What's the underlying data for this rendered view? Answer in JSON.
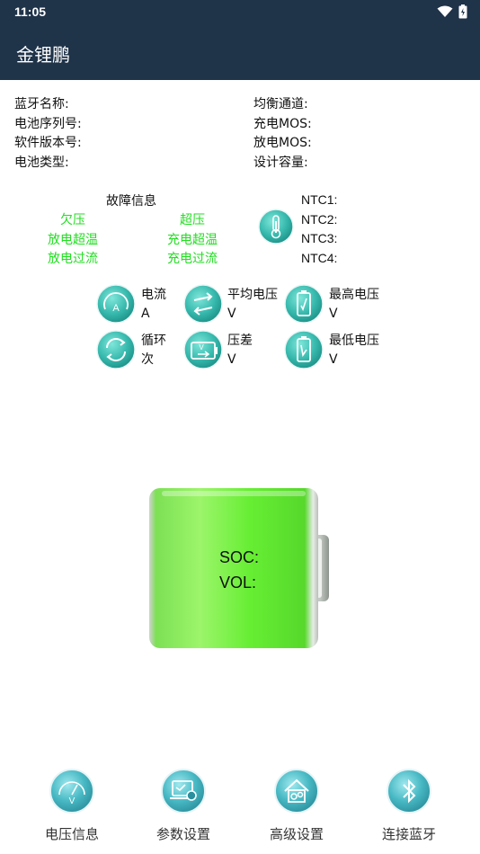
{
  "status_bar": {
    "time": "11:05"
  },
  "app_bar": {
    "title": "金锂鹏"
  },
  "info_left": [
    "蓝牙名称:",
    "电池序列号:",
    "软件版本号:",
    "电池类型:"
  ],
  "info_right": [
    "均衡通道:",
    "充电MOS:",
    "放电MOS:",
    "设计容量:"
  ],
  "fault": {
    "title": "故障信息",
    "items": [
      "欠压",
      "超压",
      "放电超温",
      "充电超温",
      "放电过流",
      "充电过流"
    ]
  },
  "ntc": [
    "NTC1:",
    "NTC2:",
    "NTC3:",
    "NTC4:"
  ],
  "metrics": {
    "current": {
      "label": "电流",
      "unit": "A",
      "icon": "ammeter-icon"
    },
    "avg_voltage": {
      "label": "平均电压",
      "unit": "V",
      "icon": "exchange-arrows-icon"
    },
    "max_voltage": {
      "label": "最高电压",
      "unit": "V",
      "icon": "battery-high-icon"
    },
    "cycles": {
      "label": "循环",
      "unit": "次",
      "icon": "cycle-icon"
    },
    "diff_voltage": {
      "label": "压差",
      "unit": "V",
      "icon": "voltage-diff-icon"
    },
    "min_voltage": {
      "label": "最低电压",
      "unit": "V",
      "icon": "battery-low-icon"
    }
  },
  "battery": {
    "soc_label": "SOC:",
    "vol_label": "VOL:",
    "fill_color": "#66ee33"
  },
  "bottom_nav": [
    {
      "label": "电压信息",
      "icon": "voltmeter-icon"
    },
    {
      "label": "参数设置",
      "icon": "settings-monitor-icon"
    },
    {
      "label": "高级设置",
      "icon": "advanced-home-icon"
    },
    {
      "label": "连接蓝牙",
      "icon": "bluetooth-icon"
    }
  ],
  "colors": {
    "header": "#1f3349",
    "accent": "#3cb8b0",
    "fault_text": "#22dd22"
  }
}
